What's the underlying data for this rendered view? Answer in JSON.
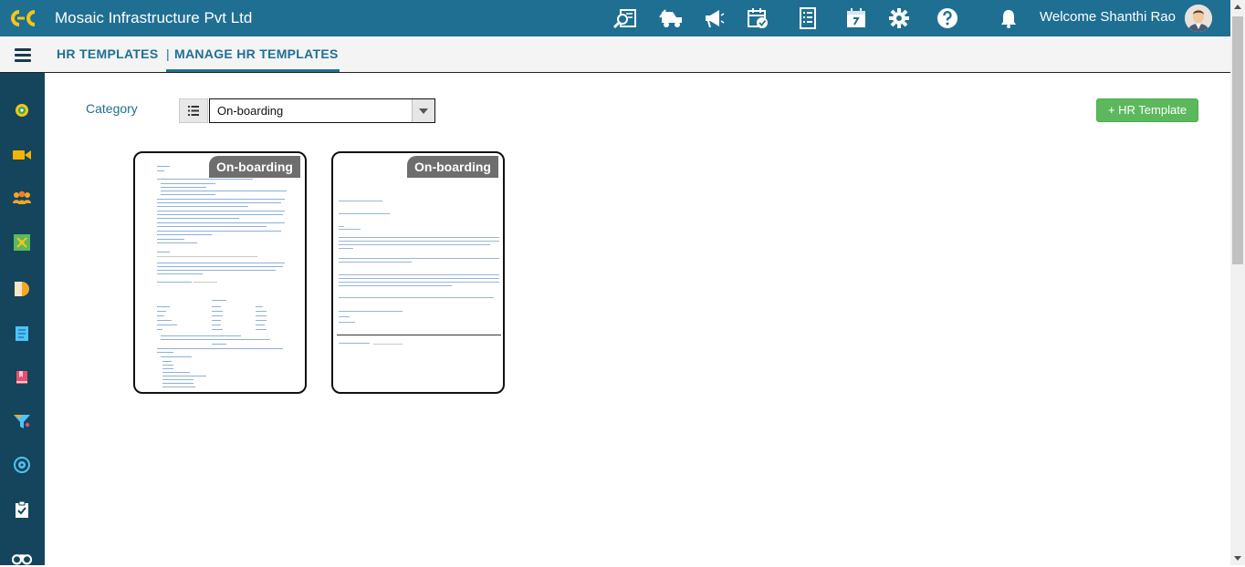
{
  "header": {
    "company": "Mosaic Infrastructure Pvt Ltd",
    "welcome": "Welcome Shanthi Rao",
    "icons": [
      "search-document-icon",
      "truck-icon",
      "megaphone-icon",
      "calendar-check-icon",
      "checklist-icon",
      "calendar-icon",
      "gear-icon",
      "help-icon",
      "bell-icon"
    ]
  },
  "breadcrumb": {
    "section": "HR TEMPLATES",
    "separator": "|",
    "page": "MANAGE HR TEMPLATES"
  },
  "sidebar": {
    "icons": [
      "dashboard-icon",
      "video-icon",
      "people-icon",
      "network-icon",
      "pie-chart-icon",
      "notes-icon",
      "book-icon",
      "filter-icon",
      "target-icon",
      "clipboard-icon",
      "binoculars-icon"
    ]
  },
  "filter": {
    "label": "Category",
    "selected": "On-boarding"
  },
  "actions": {
    "add_label": "+ HR Template"
  },
  "templates": [
    {
      "category": "On-boarding"
    },
    {
      "category": "On-boarding"
    }
  ],
  "colors": {
    "header": "#1f6f93",
    "sidebar": "#14455c",
    "add_button": "#5cb85c",
    "badge": "#6e6e6e"
  }
}
